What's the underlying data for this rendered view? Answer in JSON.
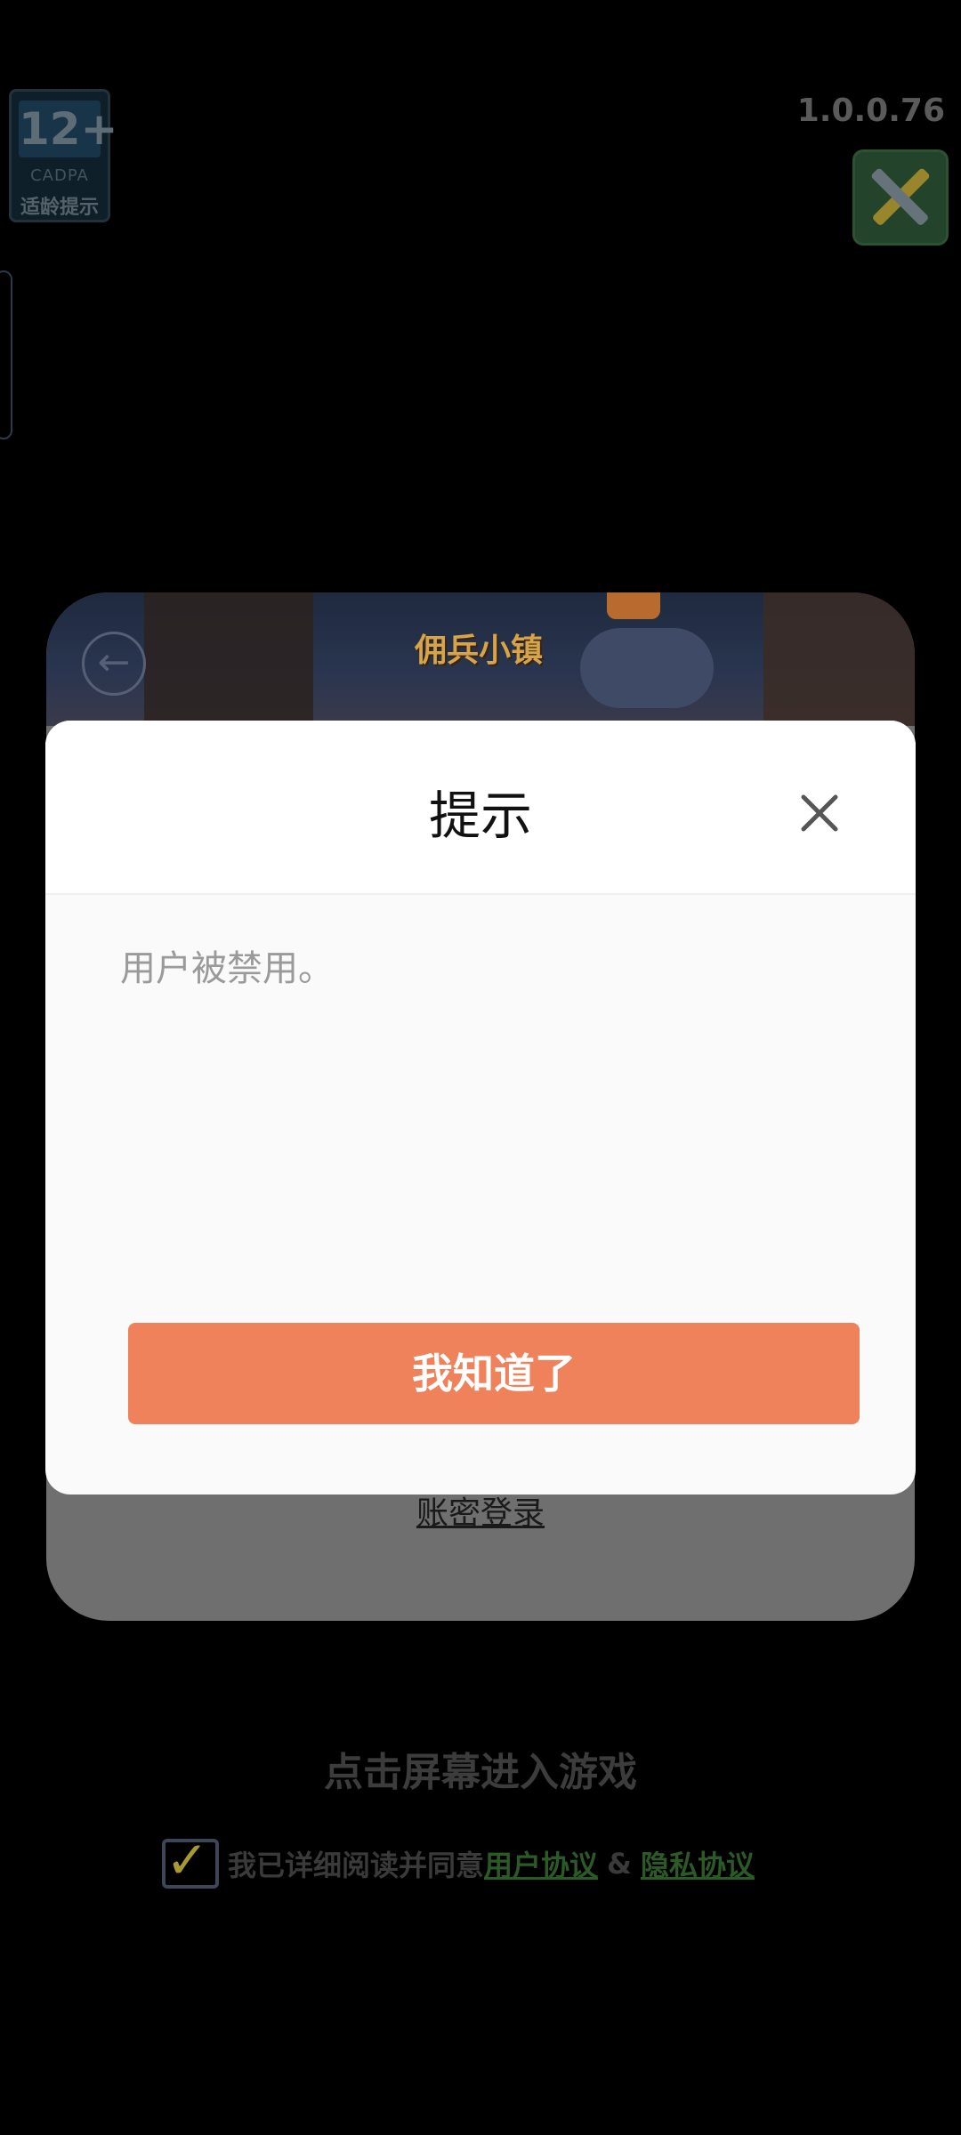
{
  "background": {
    "age_rating": {
      "number": "12+",
      "org": "CADPA",
      "tip": "适龄提示"
    },
    "version": "1.0.0.76",
    "tools_icon": "wrench-screwdriver-icon",
    "banner": {
      "logo_text": "佣兵小镇",
      "back_icon": "back-arrow-icon"
    },
    "account_login_label": "账密登录",
    "tap_to_enter": "点击屏幕进入游戏",
    "agreement": {
      "prefix": "我已详细阅读并同意",
      "user_agreement": "用户协议",
      "amp": "&",
      "privacy_agreement": "隐私协议"
    }
  },
  "dialog": {
    "title": "提示",
    "close_icon": "close-icon",
    "message": "用户被禁用。",
    "confirm_label": "我知道了"
  },
  "colors": {
    "confirm_button": "#f0825b",
    "dialog_bg": "#fafafa",
    "link_green": "#2c5a26"
  }
}
